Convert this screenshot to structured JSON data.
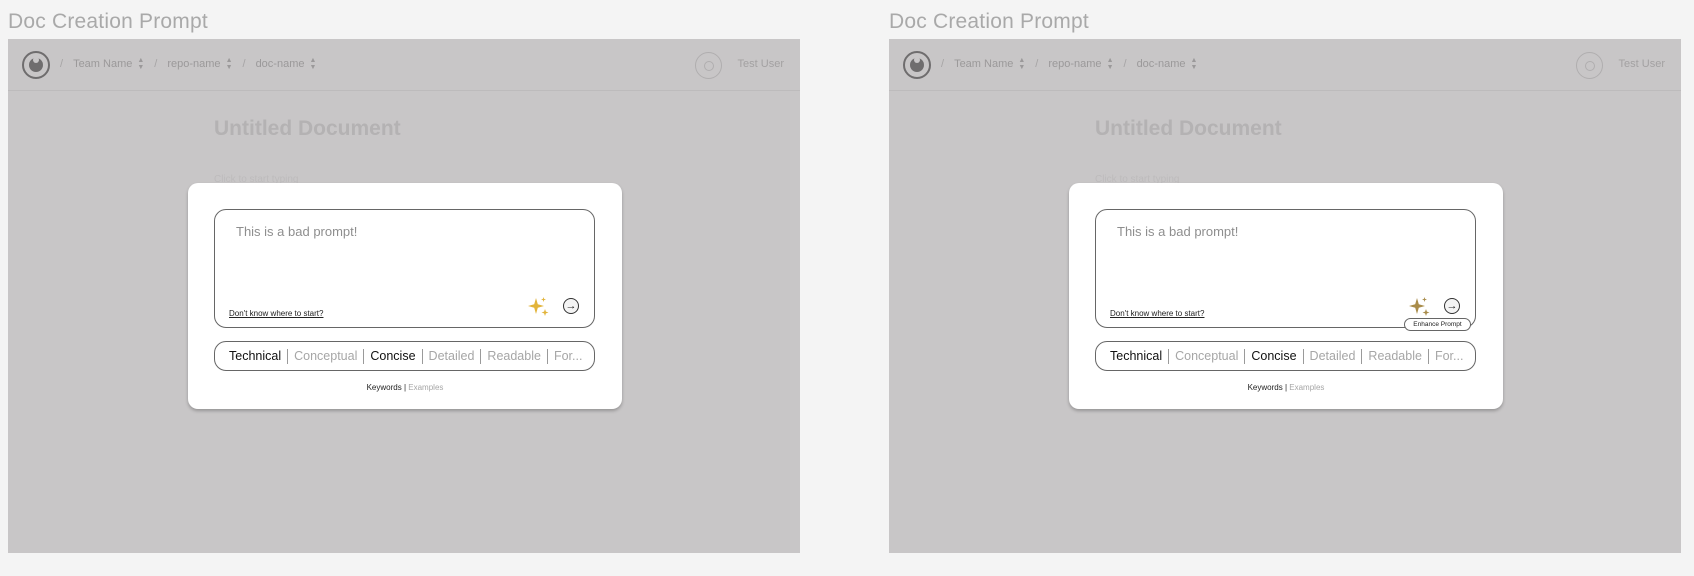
{
  "frames": [
    {
      "title": "Doc Creation Prompt",
      "nav": {
        "team": "Team Name",
        "repo": "repo-name",
        "doc": "doc-name",
        "separator": "/",
        "user": "Test User"
      },
      "document": {
        "title": "Untitled Document",
        "hint": "Click to start typing"
      },
      "modal": {
        "prompt_text": "This is a bad prompt!",
        "help_link": "Don't know where to start?",
        "tooltip": "",
        "keywords": [
          "Technical",
          "Conceptual",
          "Concise",
          "Detailed",
          "Readable",
          "For..."
        ],
        "keywords_active": [
          true,
          false,
          true,
          false,
          false,
          false
        ],
        "mode_keywords": "Keywords",
        "mode_separator": "|",
        "mode_examples": "Examples"
      }
    },
    {
      "title": "Doc Creation Prompt",
      "nav": {
        "team": "Team Name",
        "repo": "repo-name",
        "doc": "doc-name",
        "separator": "/",
        "user": "Test User"
      },
      "document": {
        "title": "Untitled Document",
        "hint": "Click to start typing"
      },
      "modal": {
        "prompt_text": "This is a bad prompt!",
        "help_link": "Don't know where to start?",
        "tooltip": "Enhance Prompt",
        "keywords": [
          "Technical",
          "Conceptual",
          "Concise",
          "Detailed",
          "Readable",
          "For..."
        ],
        "keywords_active": [
          true,
          false,
          true,
          false,
          false,
          false
        ],
        "mode_keywords": "Keywords",
        "mode_separator": "|",
        "mode_examples": "Examples"
      }
    }
  ],
  "colors": {
    "sparkle_default": "#e2b43a",
    "sparkle_hover": "#a98c4a",
    "overlay": "#c8c6c7"
  },
  "icons": {
    "logo": "steering-wheel-icon",
    "sparkle": "sparkle-icon",
    "send": "arrow-right-circle-icon",
    "updown": "chevron-up-down-icon",
    "avatar": "avatar-icon"
  }
}
